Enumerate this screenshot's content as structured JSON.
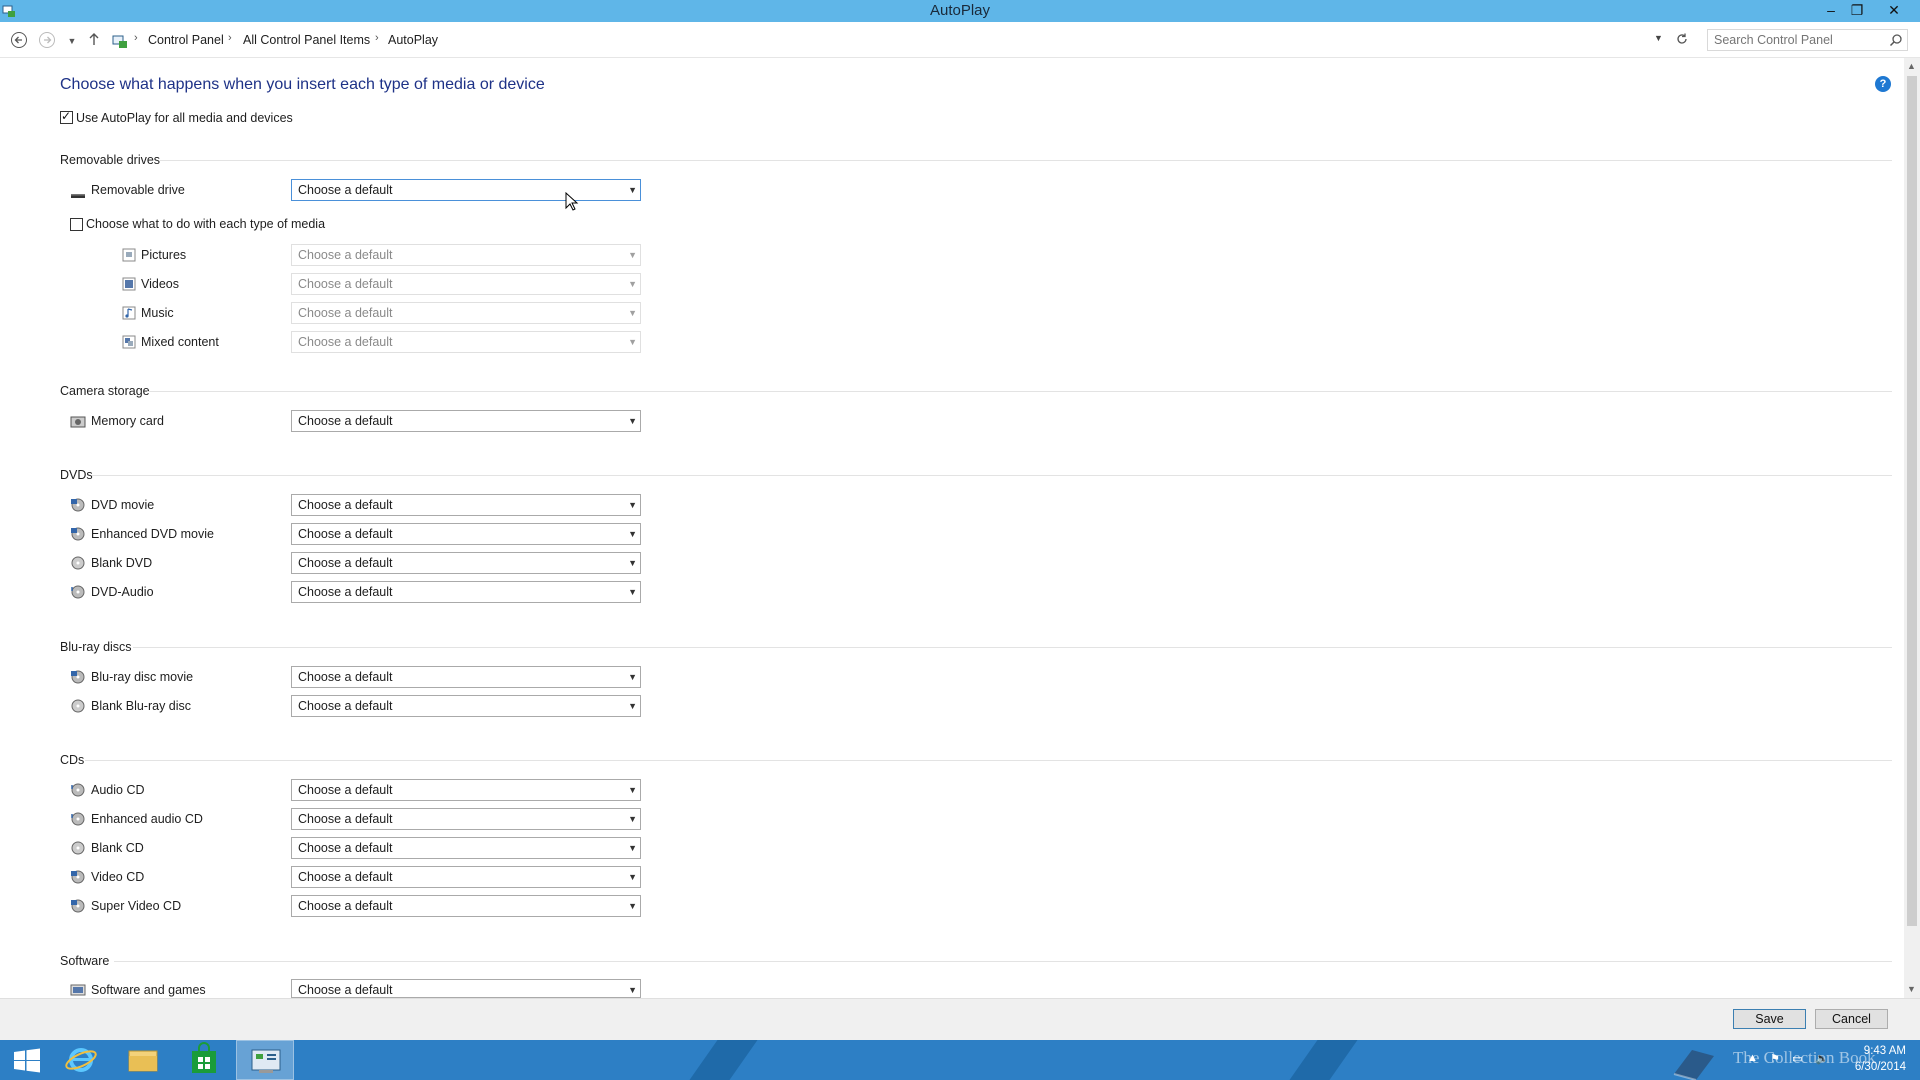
{
  "window": {
    "title": "AutoPlay"
  },
  "address": {
    "breadcrumbs": [
      "Control Panel",
      "All Control Panel Items",
      "AutoPlay"
    ],
    "search_placeholder": "Search Control Panel"
  },
  "main": {
    "heading": "Choose what happens when you insert each type of media or device",
    "use_autoplay_label": "Use AutoPlay for all media and devices",
    "use_autoplay_checked": true,
    "sections": {
      "removable": {
        "title": "Removable drives",
        "removable_drive": {
          "label": "Removable drive",
          "value": "Choose a default"
        },
        "each_media_label": "Choose what to do with each type of media",
        "each_media_checked": false,
        "media": [
          {
            "label": "Pictures",
            "value": "Choose a default"
          },
          {
            "label": "Videos",
            "value": "Choose a default"
          },
          {
            "label": "Music",
            "value": "Choose a default"
          },
          {
            "label": "Mixed content",
            "value": "Choose a default"
          }
        ]
      },
      "camera": {
        "title": "Camera storage",
        "items": [
          {
            "label": "Memory card",
            "value": "Choose a default"
          }
        ]
      },
      "dvds": {
        "title": "DVDs",
        "items": [
          {
            "label": "DVD movie",
            "value": "Choose a default"
          },
          {
            "label": "Enhanced DVD movie",
            "value": "Choose a default"
          },
          {
            "label": "Blank DVD",
            "value": "Choose a default"
          },
          {
            "label": "DVD-Audio",
            "value": "Choose a default"
          }
        ]
      },
      "bluray": {
        "title": "Blu-ray discs",
        "items": [
          {
            "label": "Blu-ray disc movie",
            "value": "Choose a default"
          },
          {
            "label": "Blank Blu-ray disc",
            "value": "Choose a default"
          }
        ]
      },
      "cds": {
        "title": "CDs",
        "items": [
          {
            "label": "Audio CD",
            "value": "Choose a default"
          },
          {
            "label": "Enhanced audio CD",
            "value": "Choose a default"
          },
          {
            "label": "Blank CD",
            "value": "Choose a default"
          },
          {
            "label": "Video CD",
            "value": "Choose a default"
          },
          {
            "label": "Super Video CD",
            "value": "Choose a default"
          }
        ]
      },
      "software": {
        "title": "Software",
        "items": [
          {
            "label": "Software and games",
            "value": "Choose a default"
          }
        ]
      }
    }
  },
  "footer": {
    "save_label": "Save",
    "cancel_label": "Cancel"
  },
  "taskbar": {
    "time": "9:43 AM",
    "date": "6/30/2014",
    "watermark": "The Collection Book",
    "accent": "#2d7fc5"
  }
}
